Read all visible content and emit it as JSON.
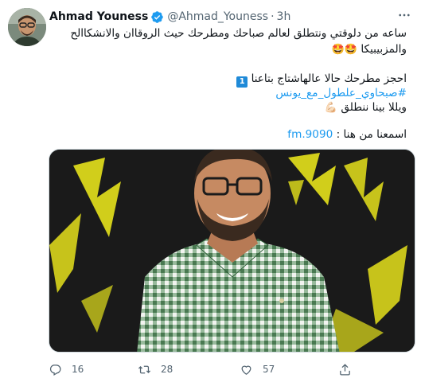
{
  "tweet": {
    "author_name": "Ahmad Youness",
    "handle": "@Ahmad_Youness",
    "separator": "·",
    "time": "3h",
    "line1": "ساعه من دلوقتي ونتطلق لعالم صباحك ومطرحك حيث الروقاان والانشكاالح",
    "line2_text": "والمزبيبيكا",
    "line2_emojis": "🤩🤩",
    "line3_text": "احجز مطرحك حالا عالهاشتاج بتاعنا",
    "line3_badge": "1",
    "hashtag": "#صبحاوي_علطول_مع_يونس",
    "line5_text": "ويللا بينا ننطلق",
    "line5_emoji": "💪🏻",
    "listen_text": "اسمعنا من هنا :",
    "listen_link": "9090.fm"
  },
  "actions": {
    "replies": "16",
    "retweets": "28",
    "likes": "57"
  },
  "colors": {
    "link": "#1d9bf0",
    "secondary_text": "#536471",
    "verified": "#1d9bf0",
    "media_accent": "#e6e21c"
  },
  "icons": {
    "verified": "verified-badge-icon",
    "more": "more-icon",
    "reply": "reply-icon",
    "retweet": "retweet-icon",
    "like": "heart-icon",
    "share": "share-icon"
  }
}
